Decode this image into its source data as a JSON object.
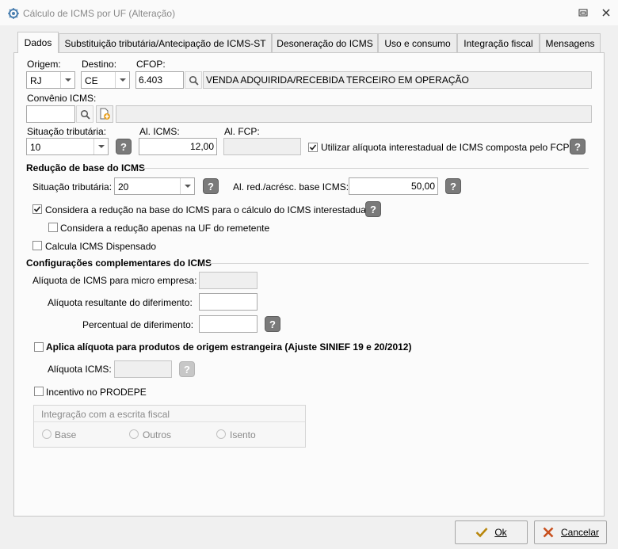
{
  "window": {
    "title": "Cálculo de ICMS por UF (Alteração)"
  },
  "tabs": [
    {
      "label": "Dados",
      "active": true
    },
    {
      "label": "Substituição tributária/Antecipação de ICMS-ST",
      "active": false
    },
    {
      "label": "Desoneração do ICMS",
      "active": false
    },
    {
      "label": "Uso e consumo",
      "active": false
    },
    {
      "label": "Integração fiscal",
      "active": false
    },
    {
      "label": "Mensagens",
      "active": false
    }
  ],
  "dados": {
    "origem_label": "Origem:",
    "origem_value": "RJ",
    "destino_label": "Destino:",
    "destino_value": "CE",
    "cfop_label": "CFOP:",
    "cfop_value": "6.403",
    "cfop_desc": "VENDA  ADQUIRIDA/RECEBIDA TERCEIRO EM OPERAÇÃO",
    "convenio_label": "Convênio ICMS:",
    "convenio_value": "",
    "convenio_desc": "",
    "situacao_label": "Situação tributária:",
    "situacao_value": "10",
    "al_icms_label": "Al. ICMS:",
    "al_icms_value": "12,00",
    "al_fcp_label": "Al. FCP:",
    "al_fcp_value": "",
    "fcp_check_label": "Utilizar alíquota interestadual de ICMS composta pelo FCP",
    "fcp_checked": true
  },
  "reducao": {
    "header": "Redução de base do ICMS",
    "situacao_label": "Situação tributária:",
    "situacao_value": "20",
    "al_red_label": "Al. red./acrésc. base ICMS:",
    "al_red_value": "50,00",
    "considera_label": "Considera a redução na base do ICMS para o cálculo do ICMS interestadual",
    "considera_checked": true,
    "considera_uf_label": "Considera a redução apenas na UF do remetente",
    "considera_uf_checked": false,
    "dispensado_label": "Calcula ICMS Dispensado",
    "dispensado_checked": false
  },
  "complementares": {
    "header": "Configurações complementares do ICMS",
    "micro_label": "Alíquota de ICMS para micro empresa:",
    "micro_value": "",
    "diferimento_label": "Alíquota resultante do diferimento:",
    "diferimento_value": "",
    "percentual_label": "Percentual de diferimento:",
    "percentual_value": "",
    "estrangeira_label": "Aplica alíquota para produtos de origem estrangeira (Ajuste SINIEF 19 e 20/2012)",
    "estrangeira_checked": false,
    "aliquota_icms_label": "Alíquota ICMS:",
    "aliquota_icms_value": "",
    "prodepe_label": "Incentivo no PRODEPE",
    "prodepe_checked": false
  },
  "integracao": {
    "title": "Integração com a escrita fiscal",
    "options": [
      "Base",
      "Outros",
      "Isento"
    ]
  },
  "buttons": {
    "ok": "Ok",
    "cancel": "Cancelar"
  },
  "colors": {
    "ok_check": "#b8860b",
    "cancel_x": "#c8501e"
  }
}
